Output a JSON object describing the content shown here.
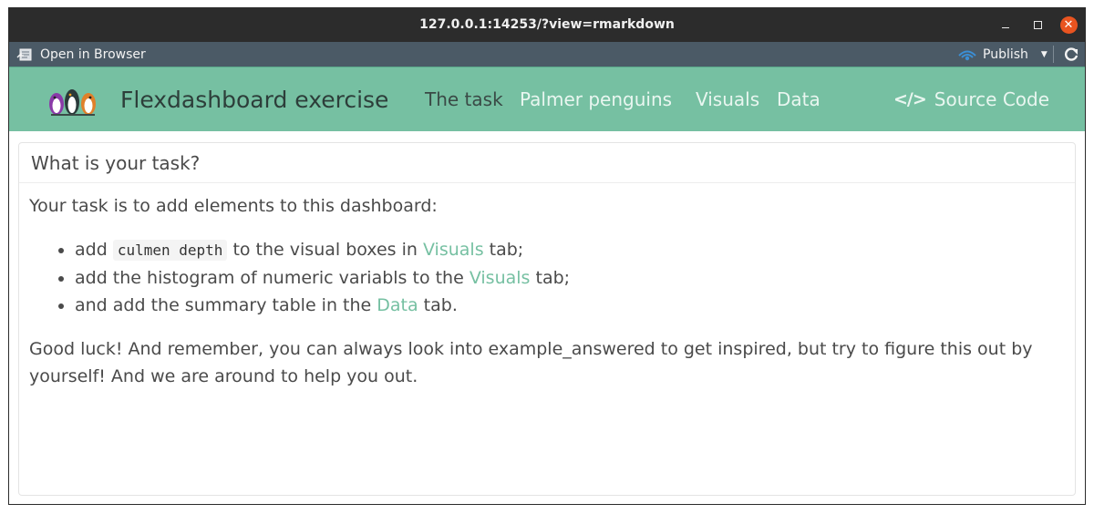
{
  "window": {
    "title": "127.0.0.1:14253/?view=rmarkdown"
  },
  "toolbar": {
    "open_in_browser": "Open in Browser",
    "publish": "Publish"
  },
  "navbar": {
    "brand_title": "Flexdashboard exercise",
    "items": [
      {
        "label": "The task",
        "active": true
      },
      {
        "label": "Palmer penguins",
        "active": false
      },
      {
        "label": "Visuals",
        "active": false
      },
      {
        "label": "Data",
        "active": false
      }
    ],
    "source_code": "Source Code",
    "accent_color": "#76c0a2"
  },
  "card": {
    "title": "What is your task?",
    "intro": "Your task is to add elements to this dashboard:",
    "tasks": [
      {
        "pre": "add ",
        "code": "culmen depth",
        "mid": " to the visual boxes in ",
        "link": "Visuals",
        "post": " tab;"
      },
      {
        "pre": "add the histogram of numeric variabls to the ",
        "link": "Visuals",
        "post": " tab;"
      },
      {
        "pre": "and add the summary table in the ",
        "link": "Data",
        "post": " tab."
      }
    ],
    "outro": "Good luck! And remember, you can always look into example_answered to get inspired, but try to figure this out by yourself! And we are around to help you out."
  }
}
